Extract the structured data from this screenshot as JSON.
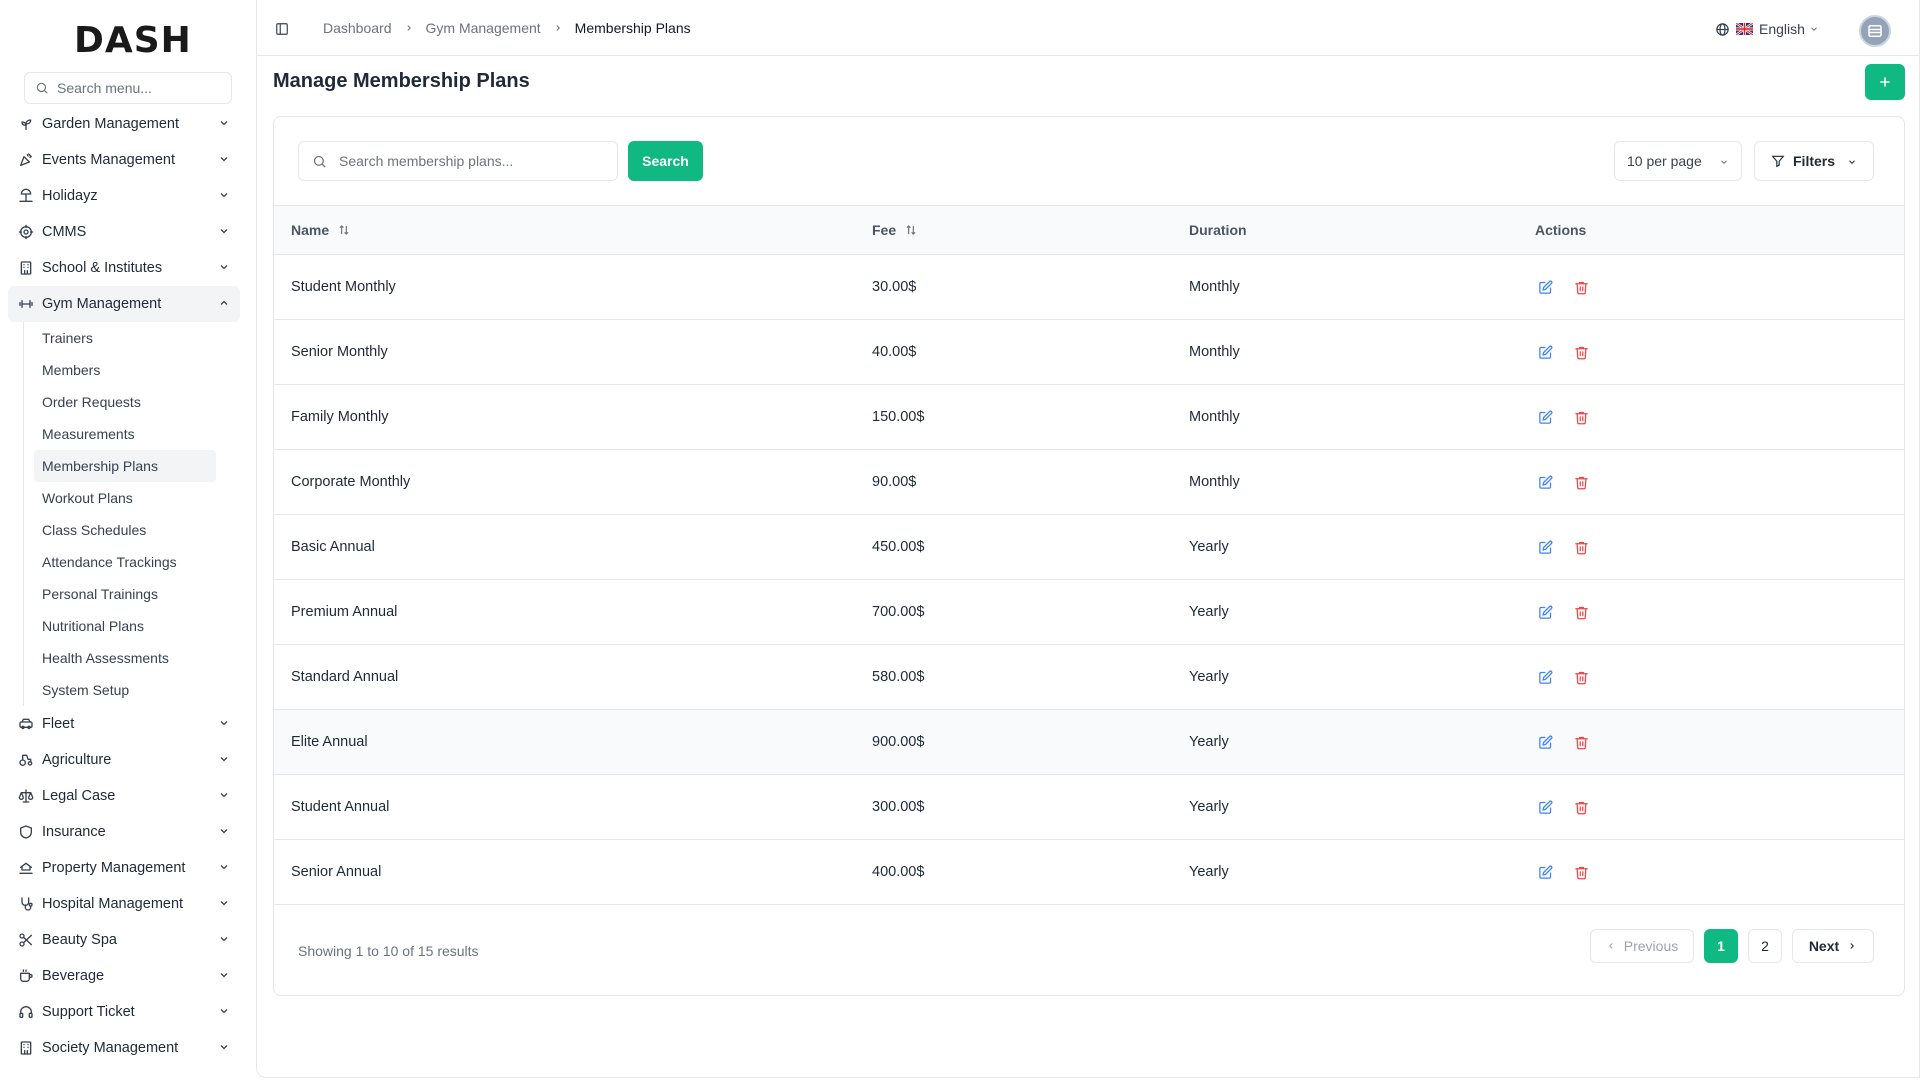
{
  "app": {
    "logo_text": "DASH"
  },
  "sidebar": {
    "search_placeholder": "Search menu...",
    "menu_top": [
      {
        "label": "Garden Management",
        "icon": "sprout-icon"
      },
      {
        "label": "Events Management",
        "icon": "party-icon"
      },
      {
        "label": "Holidayz",
        "icon": "beach-icon"
      },
      {
        "label": "CMMS",
        "icon": "cog-icon"
      },
      {
        "label": "School & Institutes",
        "icon": "building-icon"
      }
    ],
    "active_group": {
      "label": "Gym Management",
      "icon": "dumbbell-icon"
    },
    "sub_items": [
      "Trainers",
      "Members",
      "Order Requests",
      "Measurements",
      "Membership Plans",
      "Workout Plans",
      "Class Schedules",
      "Attendance Trackings",
      "Personal Trainings",
      "Nutritional Plans",
      "Health Assessments",
      "System Setup"
    ],
    "active_sub_index": 4,
    "menu_bottom": [
      {
        "label": "Fleet",
        "icon": "car-icon"
      },
      {
        "label": "Agriculture",
        "icon": "tractor-icon"
      },
      {
        "label": "Legal Case",
        "icon": "scale-icon"
      },
      {
        "label": "Insurance",
        "icon": "shield-icon"
      },
      {
        "label": "Property Management",
        "icon": "home-hand-icon"
      },
      {
        "label": "Hospital Management",
        "icon": "stethoscope-icon"
      },
      {
        "label": "Beauty Spa",
        "icon": "scissors-icon"
      },
      {
        "label": "Beverage",
        "icon": "cup-icon"
      },
      {
        "label": "Support Ticket",
        "icon": "headset-icon"
      },
      {
        "label": "Society Management",
        "icon": "building-icon"
      }
    ]
  },
  "header": {
    "breadcrumb": [
      "Dashboard",
      "Gym Management",
      "Membership Plans"
    ],
    "language": "English"
  },
  "page": {
    "title": "Manage Membership Plans",
    "search_placeholder": "Search membership plans...",
    "search_button": "Search",
    "per_page": "10 per page",
    "filters_label": "Filters"
  },
  "table": {
    "columns": [
      "Name",
      "Fee",
      "Duration",
      "Actions"
    ],
    "rows": [
      {
        "name": "Student Monthly",
        "fee": "30.00$",
        "duration": "Monthly"
      },
      {
        "name": "Senior Monthly",
        "fee": "40.00$",
        "duration": "Monthly"
      },
      {
        "name": "Family Monthly",
        "fee": "150.00$",
        "duration": "Monthly"
      },
      {
        "name": "Corporate Monthly",
        "fee": "90.00$",
        "duration": "Monthly"
      },
      {
        "name": "Basic Annual",
        "fee": "450.00$",
        "duration": "Yearly"
      },
      {
        "name": "Premium Annual",
        "fee": "700.00$",
        "duration": "Yearly"
      },
      {
        "name": "Standard Annual",
        "fee": "580.00$",
        "duration": "Yearly"
      },
      {
        "name": "Elite Annual",
        "fee": "900.00$",
        "duration": "Yearly"
      },
      {
        "name": "Student Annual",
        "fee": "300.00$",
        "duration": "Yearly"
      },
      {
        "name": "Senior Annual",
        "fee": "400.00$",
        "duration": "Yearly"
      }
    ],
    "highlighted_row_index": 7
  },
  "footer": {
    "showing": "Showing 1 to 10 of 15 results",
    "prev": "Previous",
    "pages": [
      "1",
      "2"
    ],
    "active_page": "1",
    "next": "Next"
  },
  "colors": {
    "accent": "#10b981",
    "danger": "#ef4444",
    "edit": "#3b82f6"
  }
}
